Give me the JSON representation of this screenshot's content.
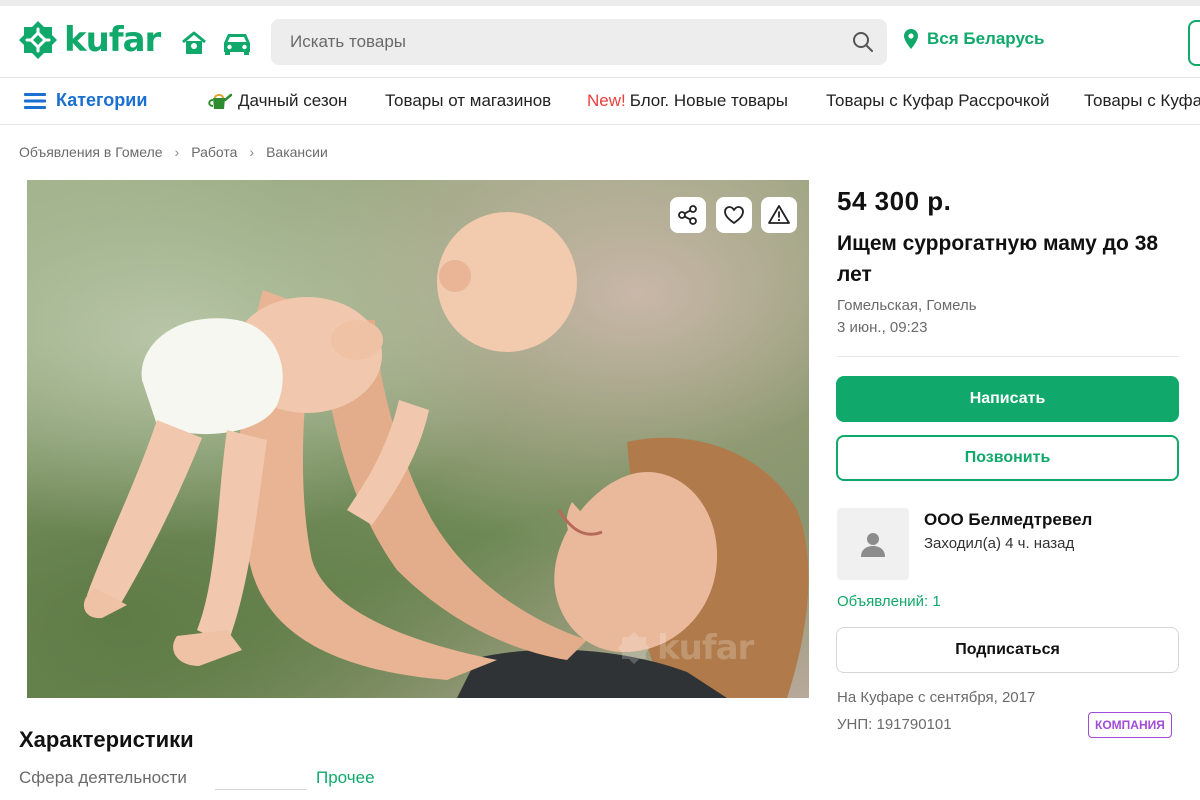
{
  "header": {
    "logo_text": "kufar",
    "search_placeholder": "Искать товары",
    "location": "Вся Беларусь",
    "brand_color": "#10a96b"
  },
  "nav": {
    "categories": "Категории",
    "items": [
      {
        "label": "Дачный сезон",
        "icon": "watering-can-icon"
      },
      {
        "label": "Товары от магазинов"
      },
      {
        "tag": "New!",
        "label": "Блог. Новые товары"
      },
      {
        "label": "Товары с Куфар Рассрочкой"
      },
      {
        "label": "Товары с Куфар"
      }
    ]
  },
  "breadcrumb": [
    "Объявления в Гомеле",
    "Работа",
    "Вакансии"
  ],
  "photo": {
    "watermark": "kufar",
    "actions": [
      "share-icon",
      "heart-icon",
      "warning-icon"
    ]
  },
  "ad": {
    "price": "54 300 р.",
    "title": "Ищем суррогатную маму до 38 лет",
    "location": "Гомельская, Гомель",
    "date": "3 июн., 09:23",
    "write_label": "Написать",
    "call_label": "Позвонить"
  },
  "seller": {
    "name": "ООО Белмедтревел",
    "last_seen": "Заходил(а) 4 ч. назад",
    "ads_count": "Объявлений: 1",
    "subscribe_label": "Подписаться",
    "since": "На Куфаре с сентября, 2017",
    "unp": "УНП: 191790101",
    "badge": "КОМПАНИЯ",
    "badge_color": "#a24bd6"
  },
  "characteristics": {
    "title": "Характеристики",
    "rows": [
      {
        "label": "Сфера деятельности",
        "value": "Прочее"
      }
    ]
  }
}
